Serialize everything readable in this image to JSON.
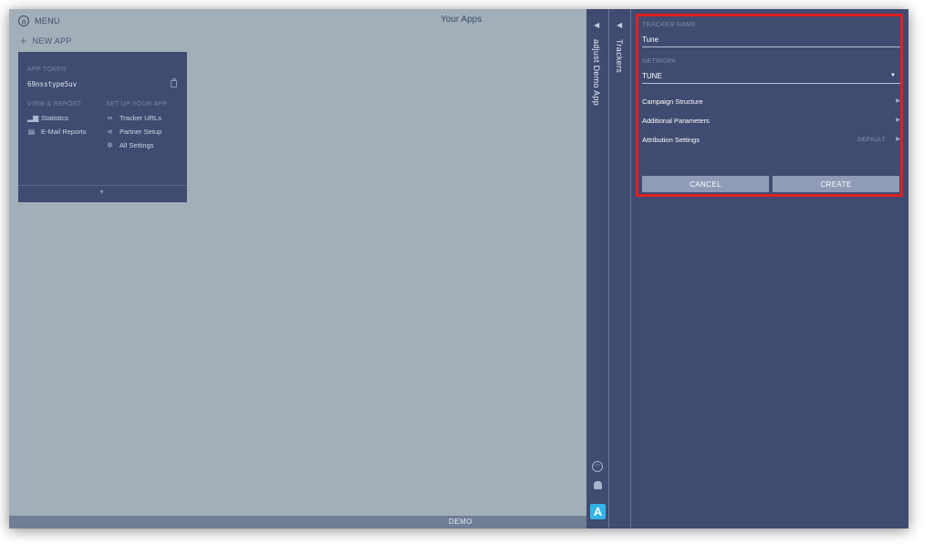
{
  "header": {
    "menu_label": "MENU",
    "page_title": "Your Apps",
    "new_app_label": "NEW APP"
  },
  "app_card": {
    "token_heading": "APP TOKEN",
    "token_value": "69nsstype5uv",
    "view_report_heading": "VIEW & REPORT",
    "setup_heading": "SET UP YOUR APP",
    "view_report_links": [
      {
        "label": "Statistics",
        "icon": "bar-chart-icon"
      },
      {
        "label": "E-Mail Reports",
        "icon": "document-icon"
      }
    ],
    "setup_links": [
      {
        "label": "Tracker URLs",
        "icon": "link-icon"
      },
      {
        "label": "Partner Setup",
        "icon": "share-icon"
      },
      {
        "label": "All Settings",
        "icon": "gear-icon"
      }
    ]
  },
  "footer": {
    "label": "DEMO"
  },
  "side_strips": {
    "app_name": "adjust Demo App",
    "trackers_label": "Trackers"
  },
  "tracker_form": {
    "name_label": "TRACKER NAME",
    "name_value": "Tune",
    "network_label": "NETWORK",
    "network_value": "TUNE",
    "sections": {
      "campaign_structure": "Campaign Structure",
      "additional_parameters": "Additional Parameters",
      "attribution_settings": "Attribution Settings",
      "attribution_value": "DEFAULT"
    },
    "cancel_label": "CANCEL",
    "create_label": "CREATE"
  },
  "colors": {
    "background": "#a2afb9",
    "panel": "#3f4b70",
    "button": "#8f9bb7",
    "highlight": "#e02020",
    "brand": "#31b4e8"
  }
}
